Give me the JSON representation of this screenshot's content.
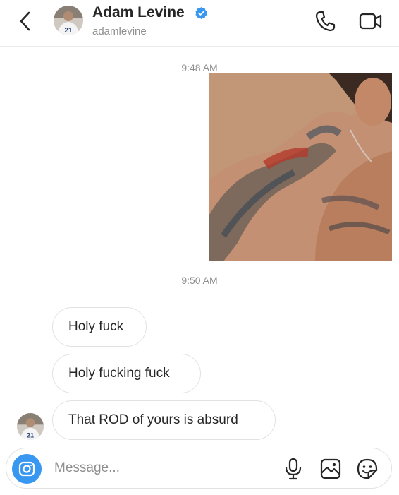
{
  "header": {
    "name": "Adam Levine",
    "username": "adamlevine",
    "avatar_jersey_number": "21"
  },
  "thread": {
    "timestamps": [
      "9:48 AM",
      "9:50 AM"
    ],
    "messages": [
      {
        "text": "Holy fuck"
      },
      {
        "text": "Holy fucking fuck"
      },
      {
        "text": "That ROD of yours is absurd"
      }
    ]
  },
  "composer": {
    "placeholder": "Message..."
  },
  "icons": {
    "back": "chevron-left-icon",
    "verified": "verified-badge-icon",
    "call": "phone-icon",
    "video": "video-camera-icon",
    "camera": "camera-icon",
    "mic": "microphone-icon",
    "gallery": "image-icon",
    "sticker": "sticker-icon"
  },
  "colors": {
    "accent": "#3897f0",
    "verified": "#3897f0",
    "text": "#262626",
    "secondary_text": "#8e8e8e",
    "bubble_border": "#e2e2e2"
  }
}
